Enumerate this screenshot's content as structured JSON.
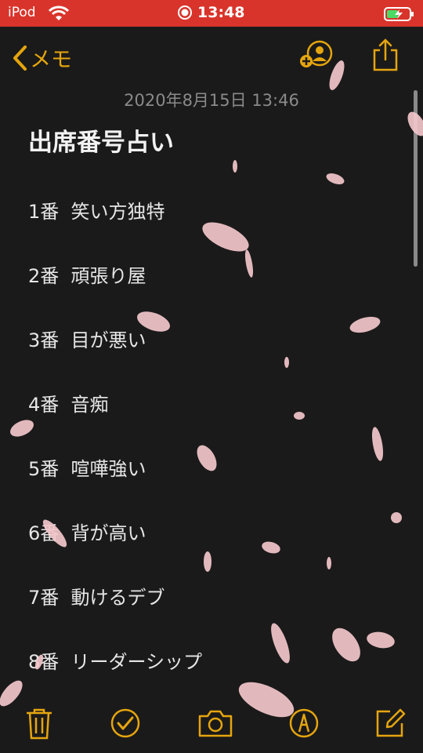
{
  "status_bar": {
    "carrier": "iPod",
    "time": "13:48"
  },
  "nav": {
    "back_label": "メモ"
  },
  "note": {
    "date": "2020年8月15日 13:46",
    "title": "出席番号占い",
    "lines": [
      "1番  笑い方独特",
      "2番  頑張り屋",
      "3番  目が悪い",
      "4番  音痴",
      "5番  喧嘩強い",
      "6番  背が高い",
      "7番  動けるデブ",
      "8番  リーダーシップ"
    ]
  },
  "colors": {
    "accent": "#e5a50e",
    "status_bar": "#d9342b",
    "background": "#1b1a1a",
    "petal": "#f3c8cc"
  },
  "icons": [
    "wifi-icon",
    "record-icon",
    "battery-charging-icon",
    "back-chevron-icon",
    "add-person-icon",
    "share-icon",
    "trash-icon",
    "checklist-icon",
    "camera-icon",
    "markup-icon",
    "compose-icon"
  ]
}
